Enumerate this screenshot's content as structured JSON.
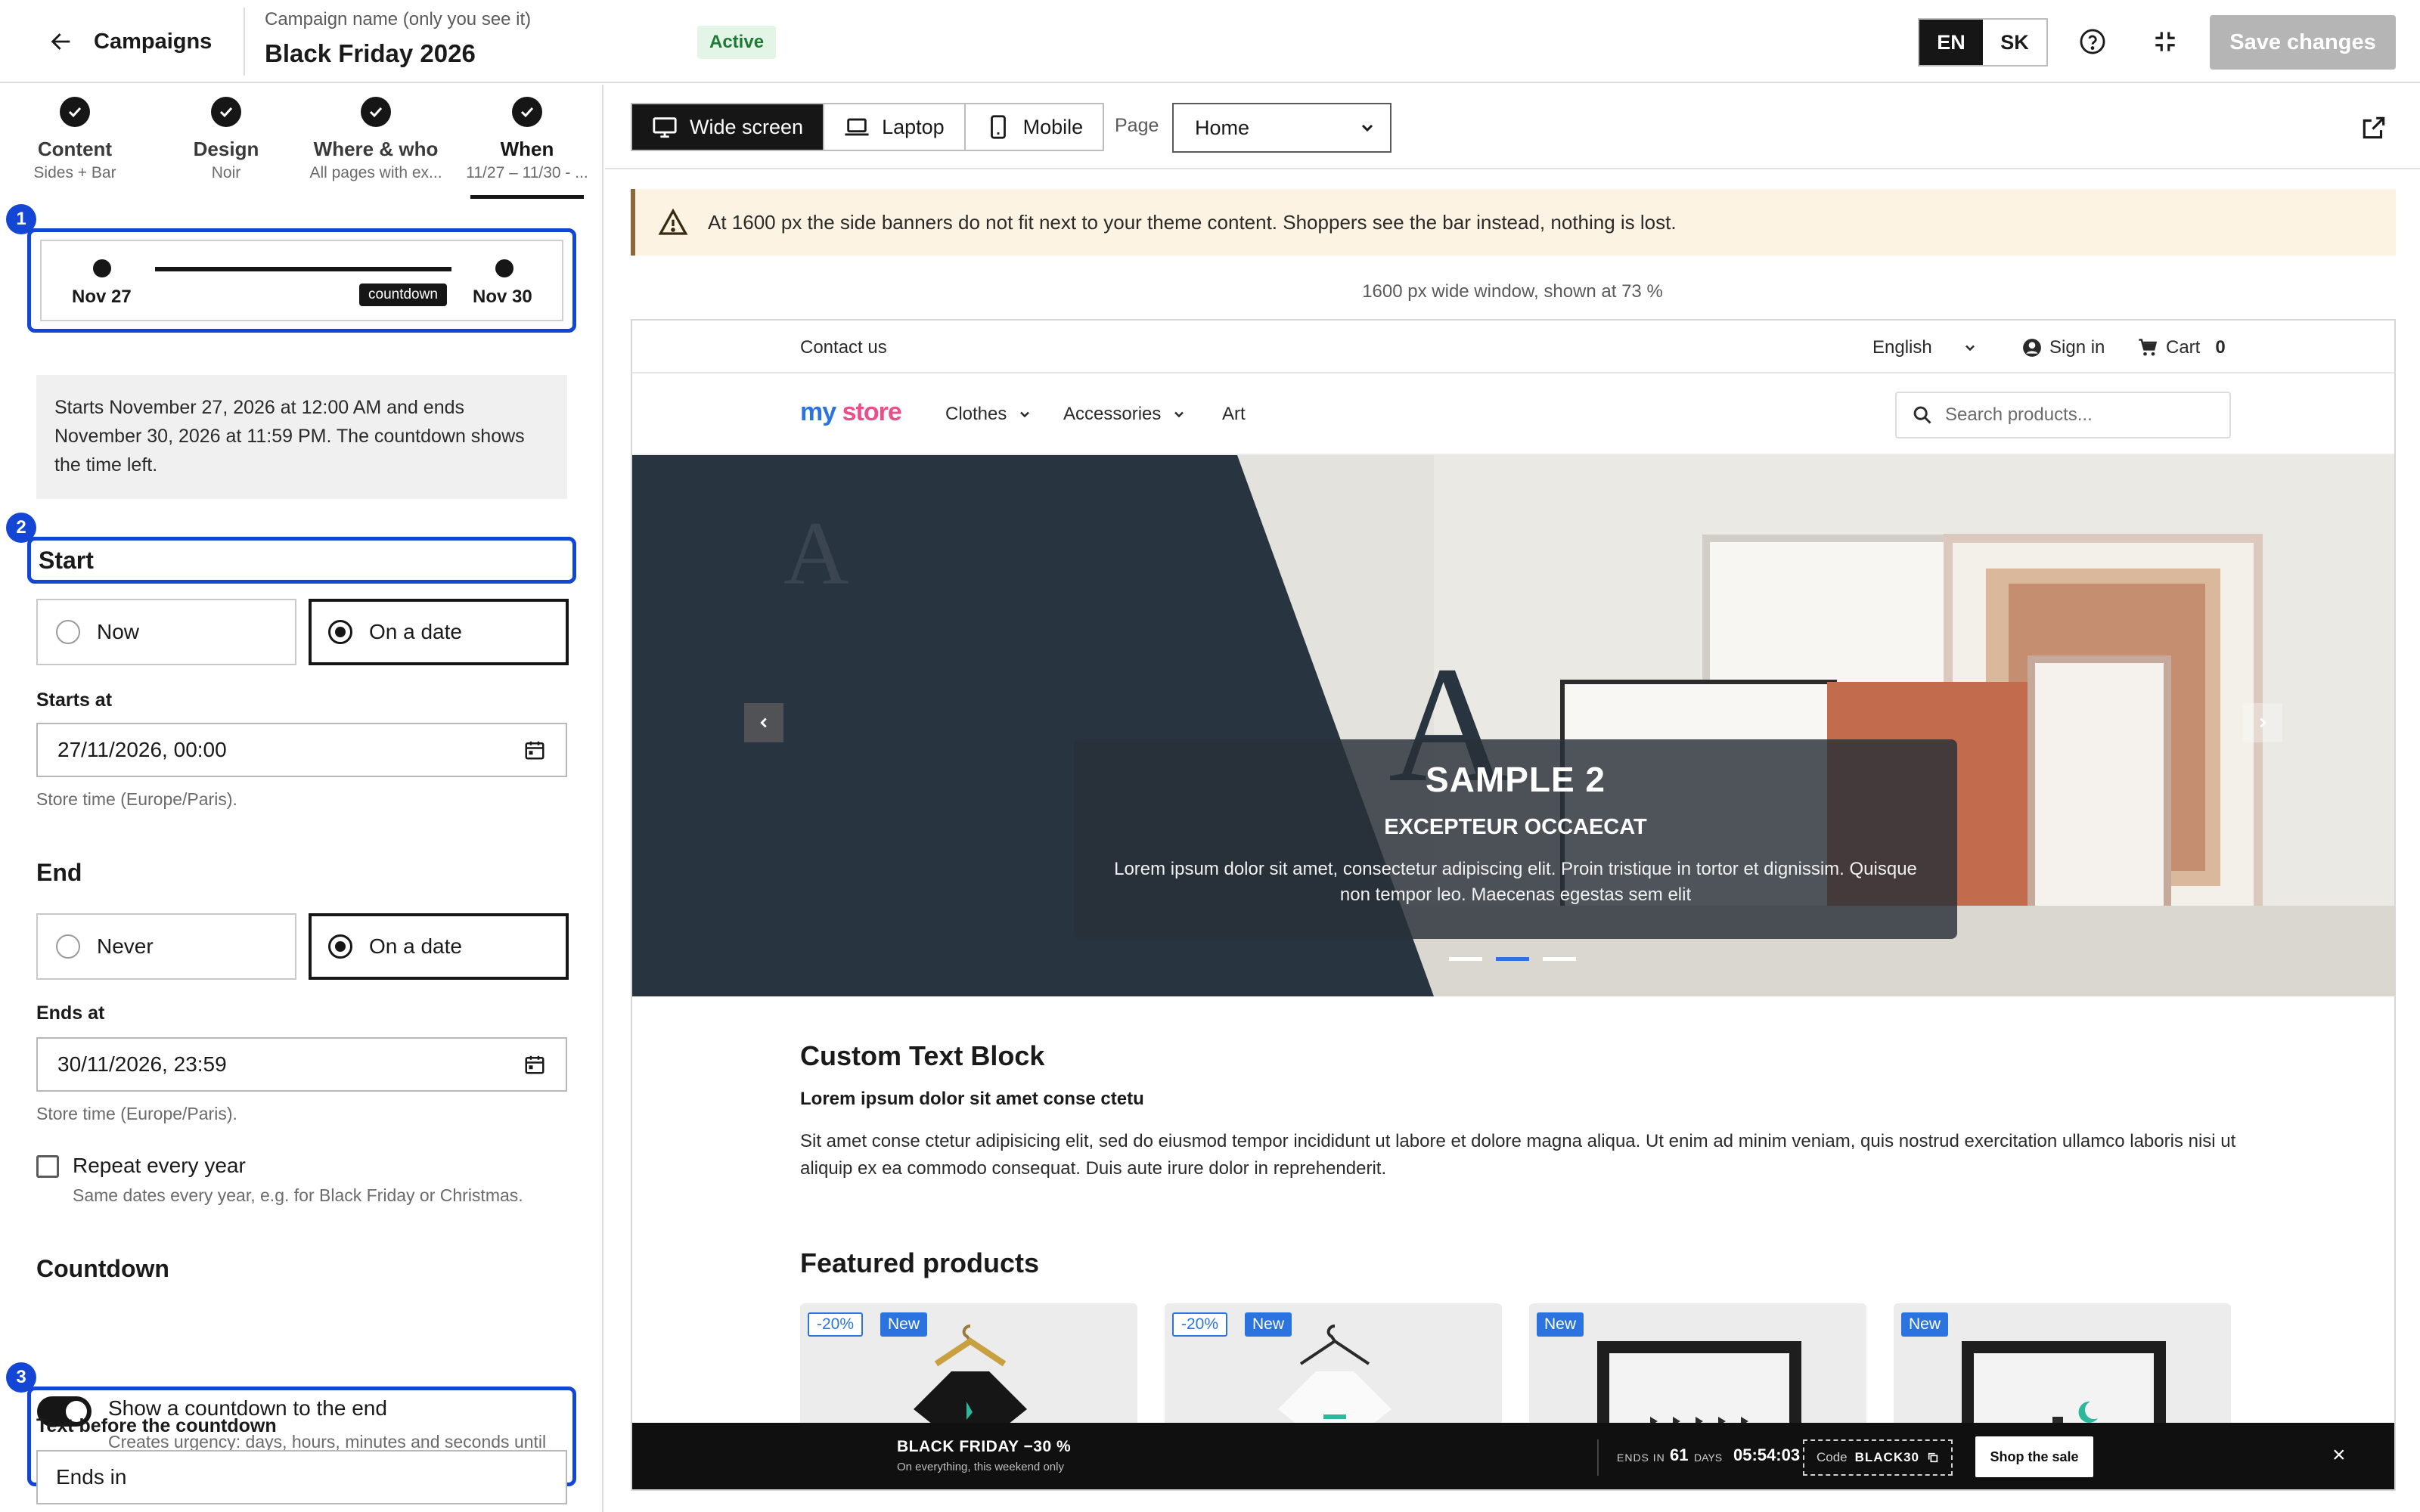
{
  "topbar": {
    "back_label": "Campaigns",
    "campaign_hint": "Campaign name (only you see it)",
    "campaign_name": "Black Friday 2026",
    "status": "Active",
    "languages": [
      "EN",
      "SK"
    ],
    "active_language": "EN",
    "save_label": "Save changes"
  },
  "steps": [
    {
      "title": "Content",
      "sub": "Sides + Bar"
    },
    {
      "title": "Design",
      "sub": "Noir"
    },
    {
      "title": "Where & who",
      "sub": "All pages with ex..."
    },
    {
      "title": "When",
      "sub": "11/27 – 11/30 - ..."
    }
  ],
  "highlights": [
    "1",
    "2",
    "3"
  ],
  "timeline": {
    "start": "Nov 27",
    "end": "Nov 30",
    "badge": "countdown"
  },
  "summary": "Starts November 27, 2026 at 12:00 AM and ends November 30, 2026 at 11:59 PM. The countdown shows the time left.",
  "start": {
    "title": "Start",
    "options": [
      "Now",
      "On a date"
    ],
    "selected": "On a date",
    "field_label": "Starts at",
    "value": "27/11/2026, 00:00",
    "help": "Store time (Europe/Paris)."
  },
  "end": {
    "title": "End",
    "options": [
      "Never",
      "On a date"
    ],
    "selected": "On a date",
    "field_label": "Ends at",
    "value": "30/11/2026, 23:59",
    "help": "Store time (Europe/Paris)."
  },
  "repeat": {
    "label": "Repeat every year",
    "help": "Same dates every year, e.g. for Black Friday or Christmas.",
    "checked": false
  },
  "countdown": {
    "title": "Countdown",
    "toggle_label": "Show a countdown to the end",
    "toggle_help": "Creates urgency: days, hours, minutes and seconds until the offer ends.",
    "enabled": true,
    "text_before_label": "Text before the countdown",
    "text_before_value": "Ends in"
  },
  "preview": {
    "devices": [
      "Wide screen",
      "Laptop",
      "Mobile"
    ],
    "active_device": "Wide screen",
    "page_label": "Page",
    "page_value": "Home",
    "warning": "At 1600 px the side banners do not fit next to your theme content. Shoppers see the bar instead, nothing is lost.",
    "caption": "1600 px wide window, shown at 73 %"
  },
  "store": {
    "contact": "Contact us",
    "language": "English",
    "sign_in": "Sign in",
    "cart": "Cart",
    "cart_count": "0",
    "logo_my": "my",
    "logo_store": "store",
    "nav": [
      "Clothes",
      "Accessories",
      "Art"
    ],
    "search_placeholder": "Search products...",
    "hero_title": "SAMPLE 2",
    "hero_subtitle": "EXCEPTEUR OCCAECAT",
    "hero_body": "Lorem ipsum dolor sit amet, consectetur adipiscing elit. Proin tristique in tortor et dignissim. Quisque non tempor leo. Maecenas egestas sem elit",
    "ctb_title": "Custom Text Block",
    "ctb_lead": "Lorem ipsum dolor sit amet conse ctetu",
    "ctb_body": "Sit amet conse ctetur adipisicing elit, sed do eiusmod tempor incididunt ut labore et dolore magna aliqua. Ut enim ad minim veniam, quis nostrud exercitation ullamco laboris nisi ut aliquip ex ea commodo consequat. Duis aute irure dolor in reprehenderit.",
    "featured_title": "Featured products",
    "products": [
      {
        "discount": "-20%",
        "badge": "New"
      },
      {
        "discount": "-20%",
        "badge": "New"
      },
      {
        "discount": "",
        "badge": "New"
      },
      {
        "discount": "",
        "badge": "New"
      }
    ]
  },
  "salebar": {
    "title": "BLACK FRIDAY −30 %",
    "subtitle": "On everything, this weekend only",
    "ends_label": "ENDS IN",
    "days": "61",
    "days_label": "DAYS",
    "time": "05:54:03",
    "code_label": "Code",
    "code": "BLACK30",
    "cta": "Shop the sale",
    "close": "×"
  },
  "colors": {
    "accent": "#1446d6",
    "dark": "#161616",
    "status_green": "#1e7a34",
    "warning_bg": "#fdf3e3",
    "store_blue": "#2b74e0"
  }
}
